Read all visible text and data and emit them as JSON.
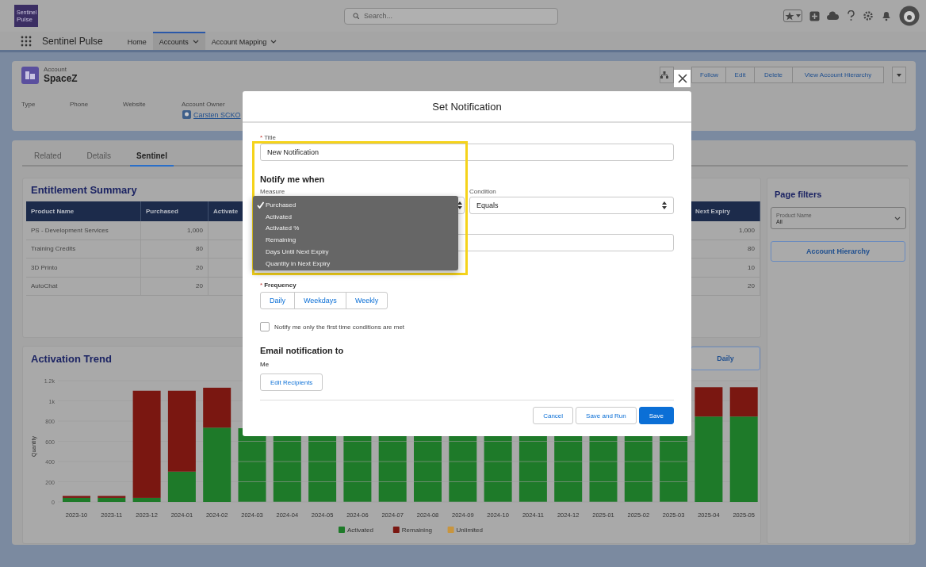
{
  "app": {
    "logo_lines": [
      "Sentinel",
      "Pulse"
    ],
    "name": "Sentinel Pulse",
    "nav": [
      {
        "label": "Home",
        "selected": false,
        "menu": false
      },
      {
        "label": "Accounts",
        "selected": true,
        "menu": true
      },
      {
        "label": "Account Mapping",
        "selected": false,
        "menu": true
      }
    ]
  },
  "global_search": {
    "placeholder": "Search..."
  },
  "record": {
    "type_label": "Account",
    "name": "SpaceZ",
    "actions": [
      "Follow",
      "Edit",
      "Delete",
      "View Account Hierarchy"
    ],
    "fields": [
      {
        "label": "Type"
      },
      {
        "label": "Phone"
      },
      {
        "label": "Website"
      },
      {
        "label": "Account Owner",
        "value": "Carsten SCKO"
      }
    ]
  },
  "record_tabs": [
    {
      "label": "Related",
      "selected": false
    },
    {
      "label": "Details",
      "selected": false
    },
    {
      "label": "Sentinel",
      "selected": true
    }
  ],
  "entitlement_summary": {
    "title": "Entitlement Summary",
    "columns": [
      "Product Name",
      "Purchased",
      "Activate",
      "Next Expiry"
    ],
    "rows": [
      [
        "PS - Development Services",
        "1,000",
        "1,000"
      ],
      [
        "Training Credits",
        "80",
        "80"
      ],
      [
        "3D Printo",
        "20",
        "10"
      ],
      [
        "AutoChat",
        "20",
        "20"
      ]
    ]
  },
  "activation_trend": {
    "title": "Activation Trend",
    "period_button": "Daily",
    "chart_data": {
      "type": "bar",
      "stacked": true,
      "grid": true,
      "legend": true,
      "ylabel": "Quantity",
      "ylim": [
        0,
        1200
      ],
      "yticks": [
        0,
        200,
        400,
        600,
        800,
        {
          "value": 1000,
          "label": "1k"
        },
        {
          "value": 1200,
          "label": "1.2k"
        }
      ],
      "categories": [
        "2023-10",
        "2023-11",
        "2023-12",
        "2024-01",
        "2024-02",
        "2024-03",
        "2024-04",
        "2024-05",
        "2024-06",
        "2024-07",
        "2024-08",
        "2024-09",
        "2024-10",
        "2024-11",
        "2024-12",
        "2025-01",
        "2025-02",
        "2025-03",
        "2025-04",
        "2025-05"
      ],
      "series": [
        {
          "name": "Activated",
          "color": "#1e7a29",
          "values": [
            40,
            40,
            40,
            300,
            735,
            null,
            null,
            null,
            null,
            null,
            null,
            null,
            null,
            null,
            null,
            null,
            null,
            null,
            845,
            845
          ]
        },
        {
          "name": "Remaining",
          "color": "#7a1711",
          "values": [
            20,
            20,
            1060,
            800,
            395,
            null,
            null,
            null,
            null,
            null,
            null,
            null,
            null,
            null,
            null,
            null,
            null,
            null,
            290,
            290
          ]
        },
        {
          "name": "Unlimited",
          "color": "#c8953e",
          "values": [
            0,
            0,
            0,
            0,
            0,
            null,
            null,
            null,
            null,
            null,
            null,
            null,
            null,
            null,
            null,
            null,
            null,
            null,
            0,
            0
          ]
        }
      ]
    }
  },
  "page_filters": {
    "title": "Page filters",
    "filter": {
      "label": "Product Name",
      "value": "All"
    },
    "button": "Account Hierarchy"
  },
  "modal": {
    "title": "Set Notification",
    "title_field": {
      "label": "Title",
      "marker": "*",
      "value": "New Notification"
    },
    "section": "Notify me when",
    "measure": {
      "label": "Measure"
    },
    "condition": {
      "label": "Condition",
      "value": "Equals"
    },
    "measure_options": [
      {
        "label": "Purchased",
        "selected": true
      },
      {
        "label": "Activated",
        "selected": false
      },
      {
        "label": "Activated %",
        "selected": false
      },
      {
        "label": "Remaining",
        "selected": false
      },
      {
        "label": "Days Until Next Expiry",
        "selected": false
      },
      {
        "label": "Quantity in Next Expiry",
        "selected": false
      }
    ],
    "frequency": {
      "label": "Frequency",
      "marker": "*",
      "options": [
        {
          "label": "Daily",
          "selected": false
        },
        {
          "label": "Weekdays",
          "selected": false
        },
        {
          "label": "Weekly",
          "selected": false
        }
      ]
    },
    "first_time_only": {
      "label": "Notify me only the first time conditions are met",
      "checked": false
    },
    "email_section": "Email notification to",
    "recipient": "Me",
    "edit_recipients": "Edit Recipients",
    "buttons": [
      {
        "label": "Cancel",
        "kind": "neutral"
      },
      {
        "label": "Save and Run",
        "kind": "neutral"
      },
      {
        "label": "Save",
        "kind": "brand"
      }
    ]
  }
}
